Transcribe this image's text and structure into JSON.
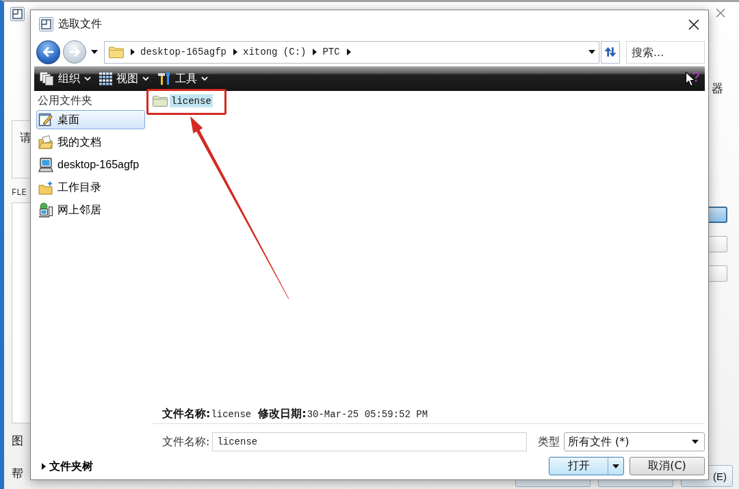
{
  "background_window": {
    "prompt_text": "请",
    "section_label": "FLE",
    "legend_label": "图",
    "help_label": "帮",
    "side_label": "器",
    "side_buttons": [
      {
        "selected": true
      },
      {
        "selected": false
      },
      {
        "selected": false
      }
    ],
    "bottom_button": "(E)"
  },
  "dialog": {
    "title": "选取文件",
    "address_bar": {
      "crumbs": [
        "desktop-165agfp",
        "xitong (C:)",
        "PTC"
      ]
    },
    "search": {
      "placeholder": "搜索..."
    },
    "toolbar": [
      {
        "label": "组织",
        "kind": "organize"
      },
      {
        "label": "视图",
        "kind": "view"
      },
      {
        "label": "工具",
        "kind": "tools"
      }
    ],
    "sidebar": {
      "heading": "公用文件夹",
      "items": [
        {
          "label": "桌面",
          "kind": "desktop",
          "selected": true
        },
        {
          "label": "我的文档",
          "kind": "documents",
          "selected": false
        },
        {
          "label": "desktop-165agfp",
          "kind": "computer",
          "selected": false
        },
        {
          "label": "工作目录",
          "kind": "workdir",
          "selected": false
        },
        {
          "label": "网上邻居",
          "kind": "network",
          "selected": false
        }
      ]
    },
    "files": [
      {
        "name": "license",
        "kind": "folder",
        "selected": true
      }
    ],
    "details": [
      {
        "label": "文件名称:",
        "value": "license"
      },
      {
        "label": "修改日期:",
        "value": "30-Mar-25 05:59:52 PM"
      }
    ],
    "file_name": {
      "label": "文件名称:",
      "value": "license"
    },
    "file_type": {
      "label": "类型",
      "value": "所有文件 (*)"
    },
    "buttons": [
      {
        "label": "打开",
        "kind": "split"
      },
      {
        "label": "取消(C)",
        "kind": "plain"
      }
    ],
    "folder_tree": {
      "label": "文件夹树",
      "expanded": false
    }
  }
}
